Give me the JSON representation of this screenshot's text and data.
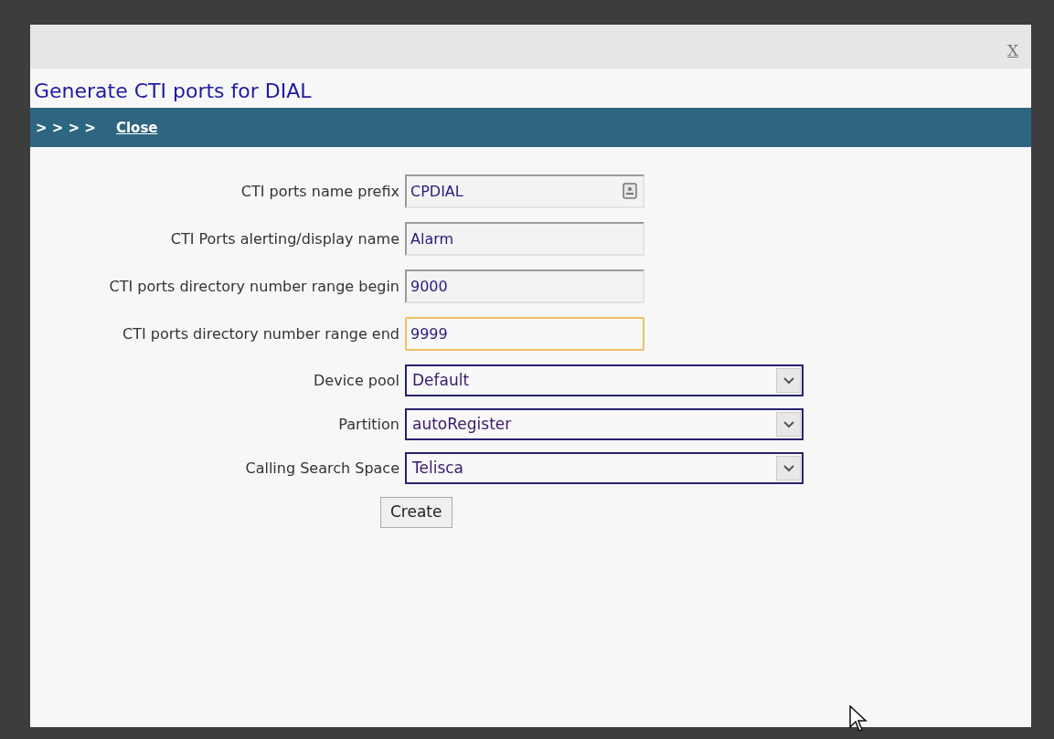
{
  "dialog": {
    "close_label": "X",
    "title": "Generate CTI ports for DIAL",
    "breadcrumb": "> > > >",
    "close_link": "Close"
  },
  "fields": [
    {
      "kind": "text",
      "label": "CTI ports name prefix",
      "value": "CPDIAL",
      "focused": false,
      "autofill_icon": true
    },
    {
      "kind": "text",
      "label": "CTI Ports alerting/display name",
      "value": "Alarm",
      "focused": false,
      "autofill_icon": false
    },
    {
      "kind": "text",
      "label": "CTI ports directory number range begin",
      "value": "9000",
      "focused": false,
      "autofill_icon": false
    },
    {
      "kind": "text",
      "label": "CTI ports directory number range end",
      "value": "9999",
      "focused": true,
      "autofill_icon": false
    },
    {
      "kind": "select",
      "label": "Device pool",
      "value": "Default"
    },
    {
      "kind": "select",
      "label": "Partition",
      "value": "autoRegister"
    },
    {
      "kind": "select",
      "label": "Calling Search Space",
      "value": "Telisca"
    }
  ],
  "create_button": "Create"
}
